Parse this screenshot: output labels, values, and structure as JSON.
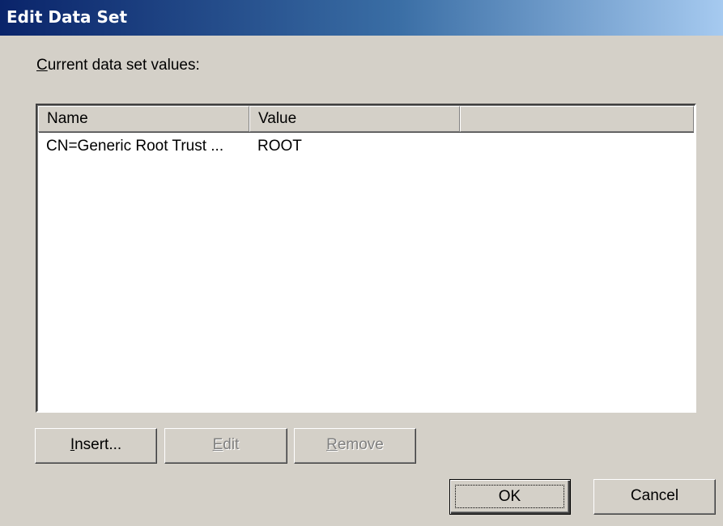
{
  "window": {
    "title": "Edit Data Set"
  },
  "dataset": {
    "label_prefix": "C",
    "label_rest": "urrent data set values:",
    "columns": [
      "Name",
      "Value",
      ""
    ],
    "rows": [
      {
        "name": "CN=Generic Root Trust ...",
        "value": "ROOT"
      }
    ]
  },
  "buttons": {
    "insert": {
      "u": "I",
      "rest": "nsert..."
    },
    "edit": {
      "u": "E",
      "rest": "dit"
    },
    "remove": {
      "u": "R",
      "rest": "emove"
    },
    "ok": "OK",
    "cancel": "Cancel"
  }
}
